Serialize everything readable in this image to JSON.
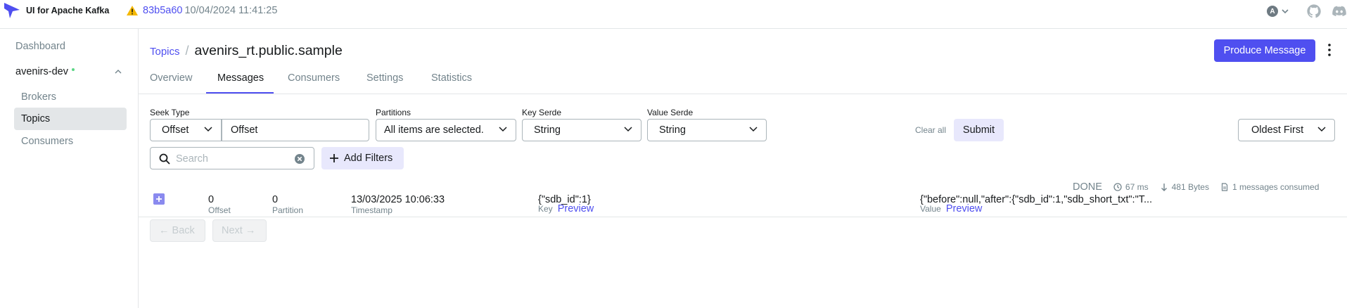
{
  "app": {
    "title": "UI for Apache Kafka",
    "version_hash": "83b5a60",
    "version_date": "10/04/2024 11:41:25",
    "user_initial": "A"
  },
  "sidebar": {
    "dashboard": "Dashboard",
    "cluster": "avenirs-dev",
    "items": [
      "Brokers",
      "Topics",
      "Consumers"
    ]
  },
  "breadcrumb": {
    "parent": "Topics",
    "separator": "/",
    "current": "avenirs_rt.public.sample"
  },
  "actions": {
    "produce": "Produce Message"
  },
  "tabs": [
    "Overview",
    "Messages",
    "Consumers",
    "Settings",
    "Statistics"
  ],
  "active_tab": "Messages",
  "filters": {
    "seek_type_label": "Seek Type",
    "seek_type_value": "Offset",
    "offset_value": "Offset",
    "partitions_label": "Partitions",
    "partitions_value": "All items are selected.",
    "key_serde_label": "Key Serde",
    "key_serde_value": "String",
    "value_serde_label": "Value Serde",
    "value_serde_value": "String",
    "clear_all": "Clear all",
    "submit": "Submit",
    "sort": "Oldest First",
    "search_placeholder": "Search",
    "add_filters": "Add Filters"
  },
  "stats": {
    "status": "DONE",
    "elapsed": "67 ms",
    "bytes": "481 Bytes",
    "consumed": "1 messages consumed"
  },
  "table": {
    "headers": {
      "offset": "Offset",
      "partition": "Partition",
      "timestamp": "Timestamp",
      "key": "Key",
      "value": "Value",
      "preview": "Preview"
    },
    "rows": [
      {
        "offset": "0",
        "partition": "0",
        "timestamp": "13/03/2025 10:06:33",
        "key": "{\"sdb_id\":1}",
        "value": "{\"before\":null,\"after\":{\"sdb_id\":1,\"sdb_short_txt\":\"T..."
      }
    ]
  },
  "pagination": {
    "back": "← Back",
    "next": "Next →"
  },
  "colors": {
    "accent": "#4f4ff0",
    "muted": "#73848c",
    "online": "#5cd685"
  }
}
